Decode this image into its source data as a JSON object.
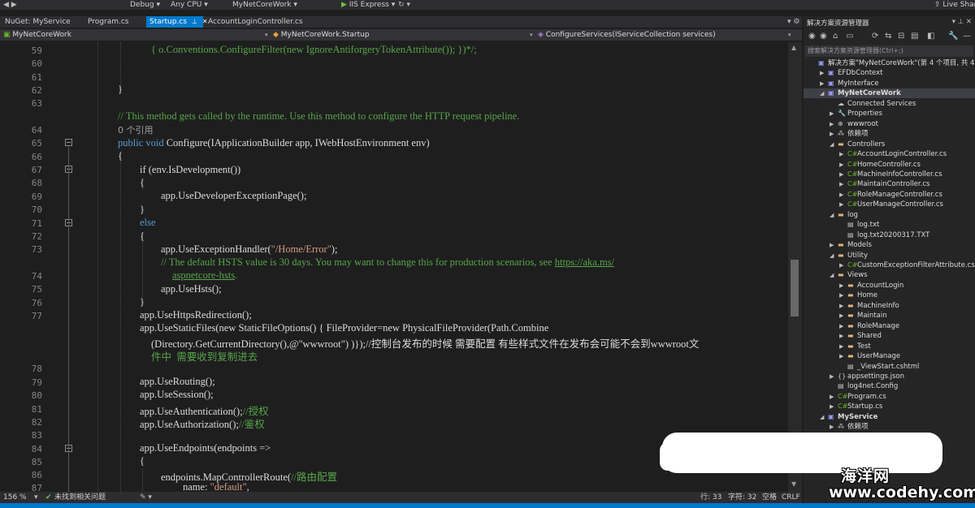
{
  "toolbar": {
    "config": "Debug",
    "platform": "Any CPU",
    "startup": "MyNetCoreWork",
    "run": "IIS Express",
    "live_share": "Live Share"
  },
  "tabs": [
    {
      "label": "NuGet: MyService"
    },
    {
      "label": "Program.cs"
    },
    {
      "label": "Startup.cs"
    },
    {
      "label": "AccountLoginController.cs"
    }
  ],
  "navbar": {
    "project": "MyNetCoreWork",
    "class": "MyNetCoreWork.Startup",
    "member": "ConfigureServices(IServiceCollection services)"
  },
  "line_numbers": [
    "59",
    "60",
    "61",
    "62",
    "63",
    "64",
    "65",
    "66",
    "67",
    "68",
    "69",
    "70",
    "71",
    "72",
    "73",
    "74",
    "75",
    "76",
    "77",
    "78",
    "79",
    "80",
    "81",
    "82",
    "83",
    "84",
    "85",
    "86",
    "87"
  ],
  "code": {
    "l59": "{ o.Conventions.ConfigureFilter(new IgnoreAntiforgeryTokenAttribute()); })*/;",
    "l61": "}",
    "l63": "// This method gets called by the runtime. Use this method to configure the HTTP request pipeline.",
    "refs": "0 个引用",
    "l64_kw": "public void",
    "l64_rest": "Configure(IApplicationBuilder app, IWebHostEnvironment env)",
    "l65": "{",
    "l66": "if (env.IsDevelopment())",
    "l67": "{",
    "l68": "app.UseDeveloperExceptionPage();",
    "l69": "}",
    "l70": "else",
    "l71": "{",
    "l72a": "app.UseExceptionHandler(",
    "l72s": "\"/Home/Error\"",
    "l72b": ");",
    "l73": "// The default HSTS value is 30 days. You may want to change this for production scenarios, see",
    "l73link": "https://aka.ms/",
    "l73link2": "aspnetcore-hsts",
    "l73end": ".",
    "l74": "app.UseHsts();",
    "l75": "}",
    "l76": "app.UseHttpsRedirection();",
    "l77a": "app.UseStaticFiles(new StaticFileOptions() { FileProvider=new PhysicalFileProvider(Path.Combine",
    "l77b": "(Directory.GetCurrentDirectory(),@\"wwwroot\") )});//控制台发布的时候 需要配置 有些样式文件在发布会可能不会到wwwroot文",
    "l77c": "件中  需要收到复制进去",
    "l79": "app.UseRouting();",
    "l80": "app.UseSession();",
    "l81a": "app.UseAuthentication();",
    "l81c": "//授权",
    "l82a": "app.UseAuthorization();",
    "l82c": "//鉴权",
    "l84": "app.UseEndpoints(endpoints =>",
    "l85": "{",
    "l86a": "endpoints.MapControllerRoute(",
    "l86c": "//路由配置",
    "l87a": "name: ",
    "l87s": "\"default\"",
    "l87b": ","
  },
  "status": {
    "zoom": "156 %",
    "issues": "未找到相关问题",
    "line": "行: 33",
    "col": "字符: 32",
    "mode": "空格",
    "eol": "CRLF"
  },
  "solution_explorer": {
    "title": "解决方案资源管理器",
    "search_placeholder": "搜索解决方案资源管理器(Ctrl+;)",
    "items": [
      {
        "label": "解决方案\"MyNetCoreWork\"(第 4 个项目, 共 4 个)"
      },
      {
        "label": "EFDbContext"
      },
      {
        "label": "MyInterface"
      },
      {
        "label": "MyNetCoreWork"
      },
      {
        "label": "Connected Services"
      },
      {
        "label": "Properties"
      },
      {
        "label": "wwwroot"
      },
      {
        "label": "依赖项"
      },
      {
        "label": "Controllers"
      },
      {
        "label": "AccountLoginController.cs"
      },
      {
        "label": "HomeController.cs"
      },
      {
        "label": "MachineInfoController.cs"
      },
      {
        "label": "MaintainController.cs"
      },
      {
        "label": "RoleManageController.cs"
      },
      {
        "label": "UserManageController.cs"
      },
      {
        "label": "log"
      },
      {
        "label": "log.txt"
      },
      {
        "label": "log.txt20200317.TXT"
      },
      {
        "label": "Models"
      },
      {
        "label": "Utility"
      },
      {
        "label": "CustomExceptionFilterAttribute.cs"
      },
      {
        "label": "Views"
      },
      {
        "label": "AccountLogin"
      },
      {
        "label": "Home"
      },
      {
        "label": "MachineInfo"
      },
      {
        "label": "Maintain"
      },
      {
        "label": "RoleManage"
      },
      {
        "label": "Shared"
      },
      {
        "label": "Test"
      },
      {
        "label": "UserManage"
      },
      {
        "label": "_ViewStart.cshtml"
      },
      {
        "label": "appsettings.json"
      },
      {
        "label": "log4net.Config"
      },
      {
        "label": "Program.cs"
      },
      {
        "label": "Startup.cs"
      },
      {
        "label": "MyService"
      },
      {
        "label": "依赖项"
      }
    ]
  },
  "watermark": {
    "line1": "海洋网",
    "line2": "www.codehy.com"
  }
}
